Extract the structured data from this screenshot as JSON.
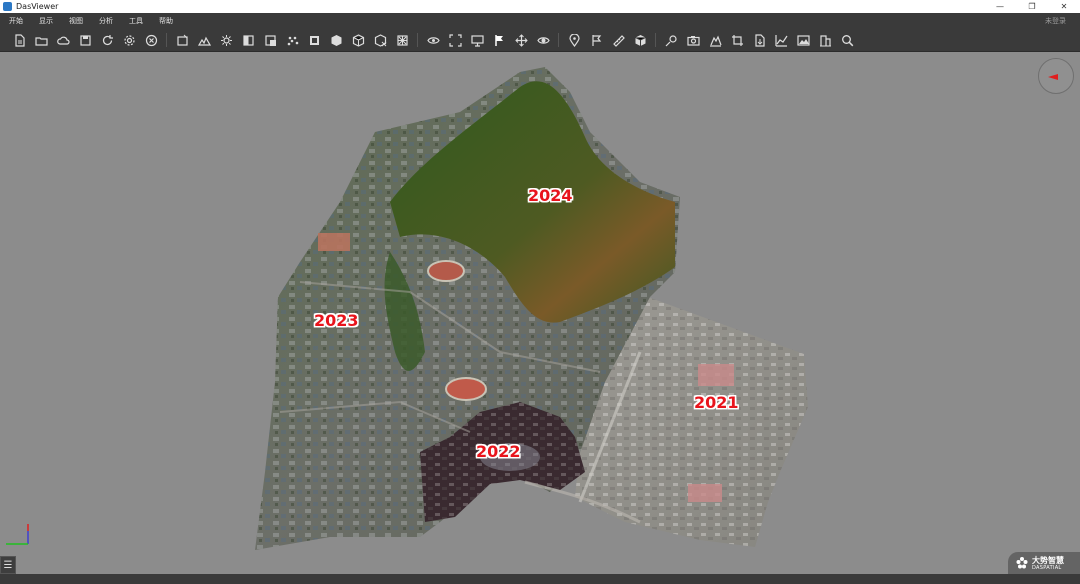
{
  "window": {
    "title": "DasViewer",
    "controls": [
      "—",
      "❐",
      "✕"
    ]
  },
  "menu": {
    "items": [
      "开始",
      "显示",
      "视图",
      "分析",
      "工具",
      "帮助"
    ],
    "login": "未登录"
  },
  "toolbar": {
    "groups": [
      [
        "new-file-icon",
        "open-folder-icon",
        "cloud-icon",
        "save-icon",
        "refresh-icon",
        "settings-icon",
        "close-circle-icon"
      ],
      [
        "model-icon",
        "terrain-icon",
        "light-icon",
        "half-tone-icon",
        "layer-icon",
        "points-icon",
        "surface-icon",
        "cube-icon",
        "box-icon",
        "wireframe-icon",
        "grid-icon"
      ],
      [
        "eye-rotate-icon",
        "fit-view-icon",
        "monitor-icon",
        "flag-measure-icon",
        "pan-icon",
        "eye-icon"
      ],
      [
        "location-icon",
        "flag-icon",
        "ruler-icon",
        "volume-icon"
      ],
      [
        "tag-icon",
        "camera-icon",
        "profile-icon",
        "crop-icon",
        "export-icon",
        "chart-icon",
        "image-icon",
        "building-icon",
        "search-icon"
      ]
    ]
  },
  "viewport": {
    "labels": [
      "2024",
      "2023",
      "2021",
      "2022"
    ]
  },
  "brand": {
    "cn": "大势智慧",
    "en": "DASPATIAL"
  },
  "statusbar": {
    "menu_icon": "☰"
  }
}
